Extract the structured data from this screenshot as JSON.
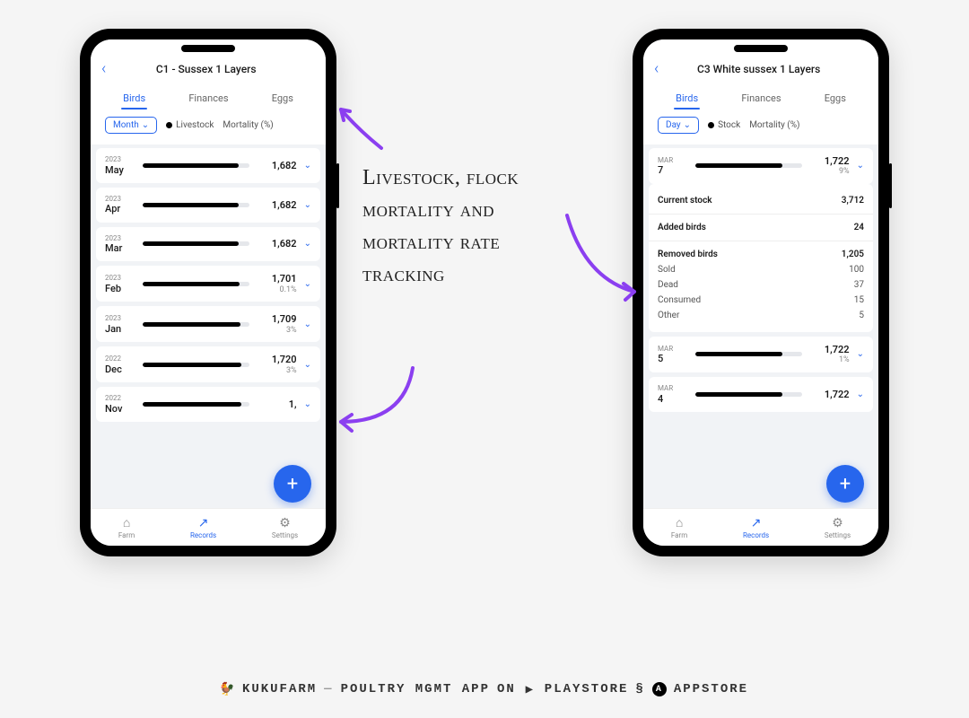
{
  "phone_left": {
    "title": "C1 - Sussex 1 Layers",
    "tabs": [
      "Birds",
      "Finances",
      "Eggs"
    ],
    "active_tab": "Birds",
    "period": "Month",
    "legend1": "Livestock",
    "legend2": "Mortality (%)",
    "rows": [
      {
        "yr": "2023",
        "mo": "May",
        "val": "1,682",
        "pct": "",
        "fill": 90
      },
      {
        "yr": "2023",
        "mo": "Apr",
        "val": "1,682",
        "pct": "",
        "fill": 90
      },
      {
        "yr": "2023",
        "mo": "Mar",
        "val": "1,682",
        "pct": "",
        "fill": 90
      },
      {
        "yr": "2023",
        "mo": "Feb",
        "val": "1,701",
        "pct": "0.1%",
        "fill": 91
      },
      {
        "yr": "2023",
        "mo": "Jan",
        "val": "1,709",
        "pct": "3%",
        "fill": 92
      },
      {
        "yr": "2022",
        "mo": "Dec",
        "val": "1,720",
        "pct": "3%",
        "fill": 93
      },
      {
        "yr": "2022",
        "mo": "Nov",
        "val": "1,",
        "pct": "",
        "fill": 93
      }
    ]
  },
  "phone_right": {
    "title": "C3 White sussex 1 Layers",
    "tabs": [
      "Birds",
      "Finances",
      "Eggs"
    ],
    "active_tab": "Birds",
    "period": "Day",
    "legend1": "Stock",
    "legend2": "Mortality (%)",
    "top_row": {
      "mo": "MAR",
      "day": "7",
      "val": "1,722",
      "pct": "9%",
      "fill": 82
    },
    "detail": {
      "current_label": "Current stock",
      "current_val": "3,712",
      "added_label": "Added birds",
      "added_val": "24",
      "removed_label": "Removed birds",
      "removed_val": "1,205",
      "breakdown": [
        {
          "label": "Sold",
          "val": "100"
        },
        {
          "label": "Dead",
          "val": "37"
        },
        {
          "label": "Consumed",
          "val": "15"
        },
        {
          "label": "Other",
          "val": "5"
        }
      ]
    },
    "rows_after": [
      {
        "mo": "MAR",
        "day": "5",
        "val": "1,722",
        "pct": "1%",
        "fill": 82
      },
      {
        "mo": "MAR",
        "day": "4",
        "val": "1,722",
        "pct": "",
        "fill": 82
      }
    ]
  },
  "nav": {
    "farm": "Farm",
    "records": "Records",
    "settings": "Settings"
  },
  "fab": "+",
  "annotation": "Livestock, flock mortality and mortality rate tracking",
  "footer": {
    "brand": "KUKUFARM",
    "sep": "—",
    "desc": "POULTRY MGMT APP",
    "on": "ON",
    "playstore": "PLAYSTORE",
    "amp": "§",
    "appstore": "APPSTORE"
  },
  "chart_data": {
    "type": "bar",
    "title": "Livestock & Mortality by Month",
    "series": [
      {
        "name": "Livestock",
        "values": [
          1682,
          1682,
          1682,
          1701,
          1709,
          1720
        ]
      },
      {
        "name": "Mortality (%)",
        "values": [
          0,
          0,
          0,
          0.1,
          3,
          3
        ]
      }
    ],
    "categories": [
      "May 2023",
      "Apr 2023",
      "Mar 2023",
      "Feb 2023",
      "Jan 2023",
      "Dec 2022"
    ]
  }
}
